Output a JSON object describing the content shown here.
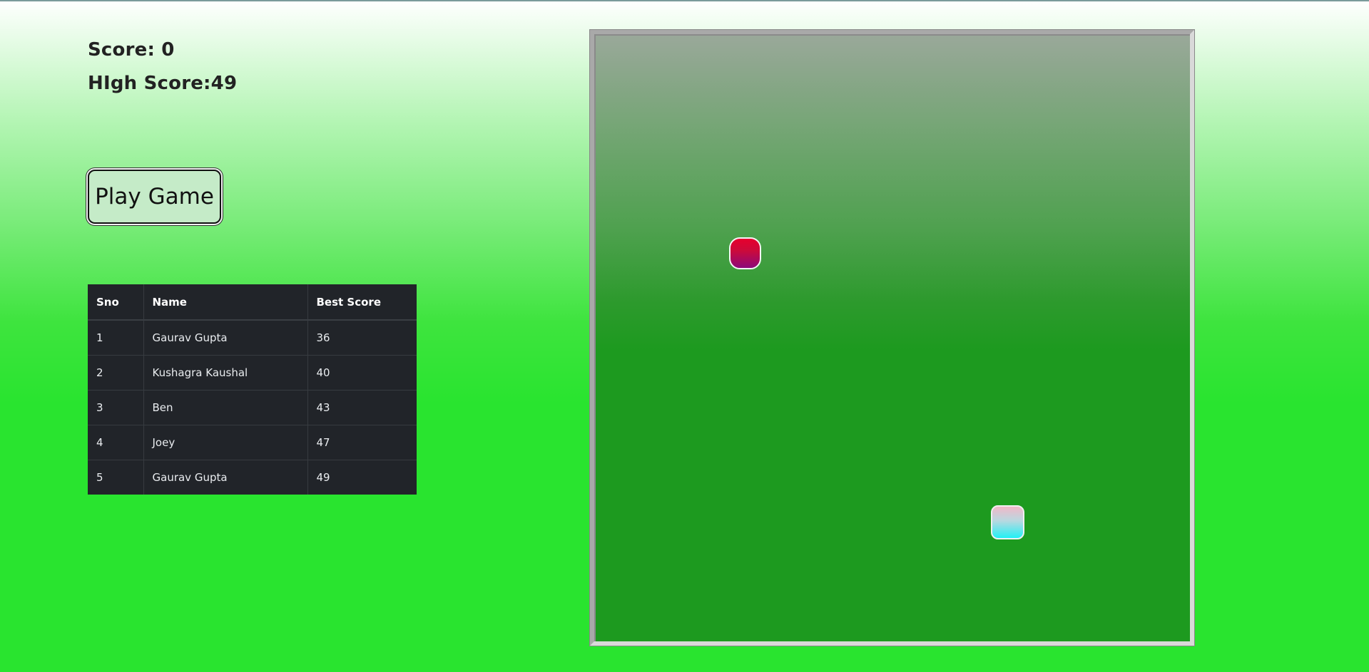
{
  "score": {
    "label": "Score: ",
    "value": "0",
    "text": "Score: 0"
  },
  "high_score": {
    "label": "HIgh Score:",
    "value": "49",
    "text": "HIgh Score:49"
  },
  "play_button": {
    "label": "Play Game"
  },
  "leaderboard": {
    "headers": [
      "Sno",
      "Name",
      "Best Score"
    ],
    "rows": [
      {
        "sno": "1",
        "name": "Gaurav Gupta",
        "best": "36"
      },
      {
        "sno": "2",
        "name": "Kushagra Kaushal",
        "best": "40"
      },
      {
        "sno": "3",
        "name": "Ben",
        "best": "43"
      },
      {
        "sno": "4",
        "name": "Joey",
        "best": "47"
      },
      {
        "sno": "5",
        "name": "Gaurav Gupta",
        "best": "49"
      }
    ]
  },
  "game": {
    "snake_head_icon": "snake-head",
    "food_icon": "food-pellet",
    "colors": {
      "food_top": "#e6002d",
      "food_bottom": "#8c0a7a",
      "snake_top": "#f2b8c8",
      "snake_bottom": "#22f0f5",
      "board": "#1d9a1f"
    }
  },
  "colors": {
    "page_background": "#29e42f",
    "table_background": "#212429",
    "button_background": "#c5ebc8"
  }
}
